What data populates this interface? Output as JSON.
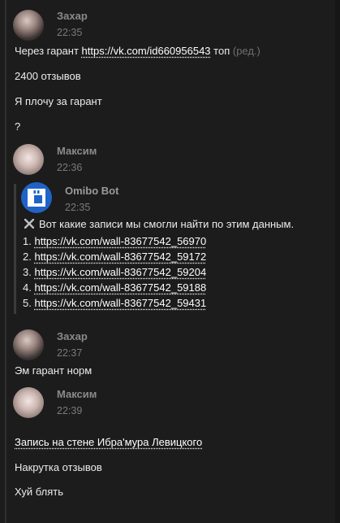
{
  "messages": {
    "zakhar1": {
      "author": "Захар",
      "time": "22:35",
      "line1_prefix": "Через гарант ",
      "line1_link": "https://vk.com/id660956543",
      "line1_suffix": " топ ",
      "line1_edited": "(ред.)",
      "line2": "2400 отзывов",
      "line3": "Я плочу за гарант",
      "line4": "?"
    },
    "maksim1": {
      "author": "Максим",
      "time": "22:36"
    },
    "bot": {
      "author": "Omibo Bot",
      "time": "22:35",
      "intro": "Вот какие записи мы смогли найти по этим данным.",
      "icon": "pin-icon",
      "results": [
        {
          "num": "1.",
          "url": "https://vk.com/wall-83677542_56970"
        },
        {
          "num": "2.",
          "url": "https://vk.com/wall-83677542_59172"
        },
        {
          "num": "3.",
          "url": "https://vk.com/wall-83677542_59204"
        },
        {
          "num": "4.",
          "url": "https://vk.com/wall-83677542_59188"
        },
        {
          "num": "5.",
          "url": "https://vk.com/wall-83677542_59431"
        }
      ]
    },
    "zakhar2": {
      "author": "Захар",
      "time": "22:37",
      "line1": "Эм гарант норм"
    },
    "maksim2": {
      "author": "Максим",
      "time": "22:39",
      "line1_link": "Запись на стене Ибра'мура Левицкого",
      "line2": "Накрутка отзывов",
      "line3": "Хуй блять"
    }
  },
  "colors": {
    "background": "#1c1c1c",
    "text": "#ececec",
    "muted": "#7a7a7a",
    "bot_avatar": "#1f63c7"
  }
}
